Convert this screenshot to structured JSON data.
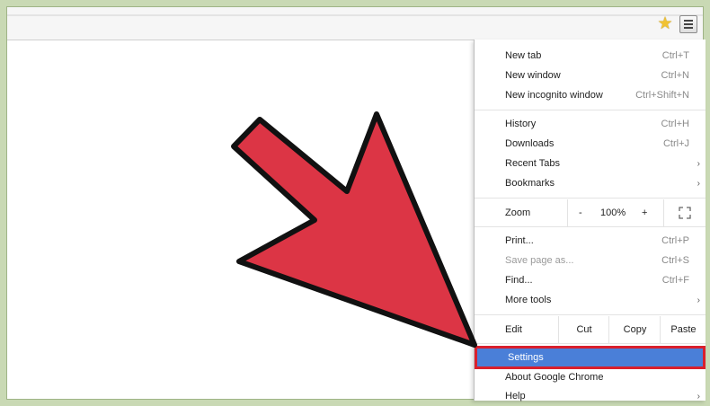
{
  "menu": {
    "group1": [
      {
        "label": "New tab",
        "shortcut": "Ctrl+T"
      },
      {
        "label": "New window",
        "shortcut": "Ctrl+N"
      },
      {
        "label": "New incognito window",
        "shortcut": "Ctrl+Shift+N"
      }
    ],
    "group2": [
      {
        "label": "History",
        "shortcut": "Ctrl+H"
      },
      {
        "label": "Downloads",
        "shortcut": "Ctrl+J"
      },
      {
        "label": "Recent Tabs",
        "submenu_arrow": "›"
      },
      {
        "label": "Bookmarks",
        "submenu_arrow": "›"
      }
    ],
    "zoom": {
      "label": "Zoom",
      "minus": "-",
      "level": "100%",
      "plus": "+",
      "fullscreen_icon": "fullscreen-icon"
    },
    "group3": [
      {
        "label": "Print...",
        "shortcut": "Ctrl+P"
      },
      {
        "label": "Save page as...",
        "shortcut": "Ctrl+S"
      },
      {
        "label": "Find...",
        "shortcut": "Ctrl+F"
      },
      {
        "label": "More tools",
        "submenu_arrow": "›"
      }
    ],
    "edit": {
      "label": "Edit",
      "cut": "Cut",
      "copy": "Copy",
      "paste": "Paste"
    },
    "settings": {
      "label": "Settings"
    },
    "about": {
      "label": "About Google Chrome"
    },
    "help": {
      "label": "Help",
      "submenu_arrow": "›"
    }
  },
  "toolbar": {
    "bookmark_icon": "star-icon",
    "menu_icon": "hamburger-menu-icon"
  },
  "colors": {
    "highlight": "#4a7fd8",
    "highlight_border": "#d9202d",
    "arrow_fill": "#dc3545",
    "frame_bg": "#c9d9b4"
  }
}
